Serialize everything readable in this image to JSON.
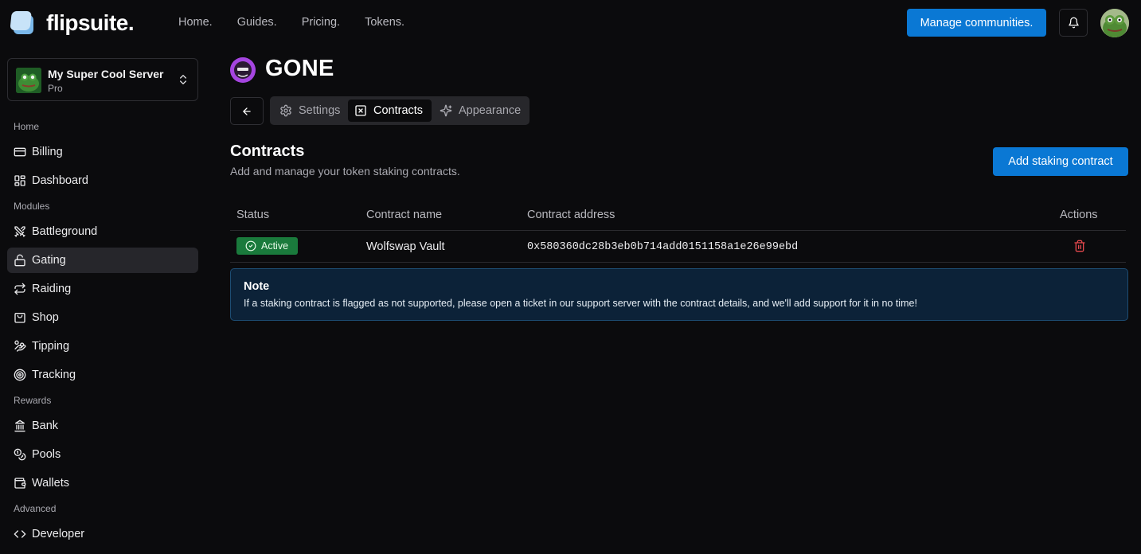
{
  "brand": {
    "name": "flipsuite.",
    "accent": "#0a78d4"
  },
  "topnav": {
    "items": [
      "Home.",
      "Guides.",
      "Pricing.",
      "Tokens."
    ]
  },
  "header": {
    "manage_label": "Manage communities."
  },
  "server": {
    "name": "My Super Cool Server",
    "plan": "Pro"
  },
  "sidebar": {
    "sections": {
      "home": "Home",
      "modules": "Modules",
      "rewards": "Rewards",
      "advanced": "Advanced"
    },
    "items": {
      "billing": {
        "label": "Billing",
        "icon": "credit-card-icon"
      },
      "dashboard": {
        "label": "Dashboard",
        "icon": "dashboard-icon"
      },
      "battleground": {
        "label": "Battleground",
        "icon": "swords-icon"
      },
      "gating": {
        "label": "Gating",
        "icon": "lock-open-icon",
        "active": true
      },
      "raiding": {
        "label": "Raiding",
        "icon": "repeat-icon"
      },
      "shop": {
        "label": "Shop",
        "icon": "shopping-bag-icon"
      },
      "tipping": {
        "label": "Tipping",
        "icon": "hand-coins-icon"
      },
      "tracking": {
        "label": "Tracking",
        "icon": "target-icon"
      },
      "bank": {
        "label": "Bank",
        "icon": "bank-icon"
      },
      "pools": {
        "label": "Pools",
        "icon": "coins-icon"
      },
      "wallets": {
        "label": "Wallets",
        "icon": "wallet-icon"
      },
      "developer": {
        "label": "Developer",
        "icon": "code-icon"
      }
    }
  },
  "page": {
    "community_name": "GONE",
    "tabs": {
      "settings": "Settings",
      "contracts": "Contracts",
      "appearance": "Appearance"
    },
    "active_tab": "Contracts"
  },
  "contracts": {
    "title": "Contracts",
    "description": "Add and manage your token staking contracts.",
    "add_label": "Add staking contract",
    "columns": {
      "status": "Status",
      "name": "Contract name",
      "address": "Contract address",
      "actions": "Actions"
    },
    "rows": [
      {
        "status": "Active",
        "name": "Wolfswap Vault",
        "address": "0x580360dc28b3eb0b714add0151158a1e26e99ebd"
      }
    ]
  },
  "note": {
    "title": "Note",
    "text": "If a staking contract is flagged as not supported, please open a ticket in our support server with the contract details, and we'll add support for it in no time!"
  },
  "colors": {
    "background": "#0b0b0d",
    "active_badge": "#1a7a3c",
    "delete": "#e5484d",
    "note_bg": "#0c2238",
    "note_border": "#1d4d73"
  }
}
